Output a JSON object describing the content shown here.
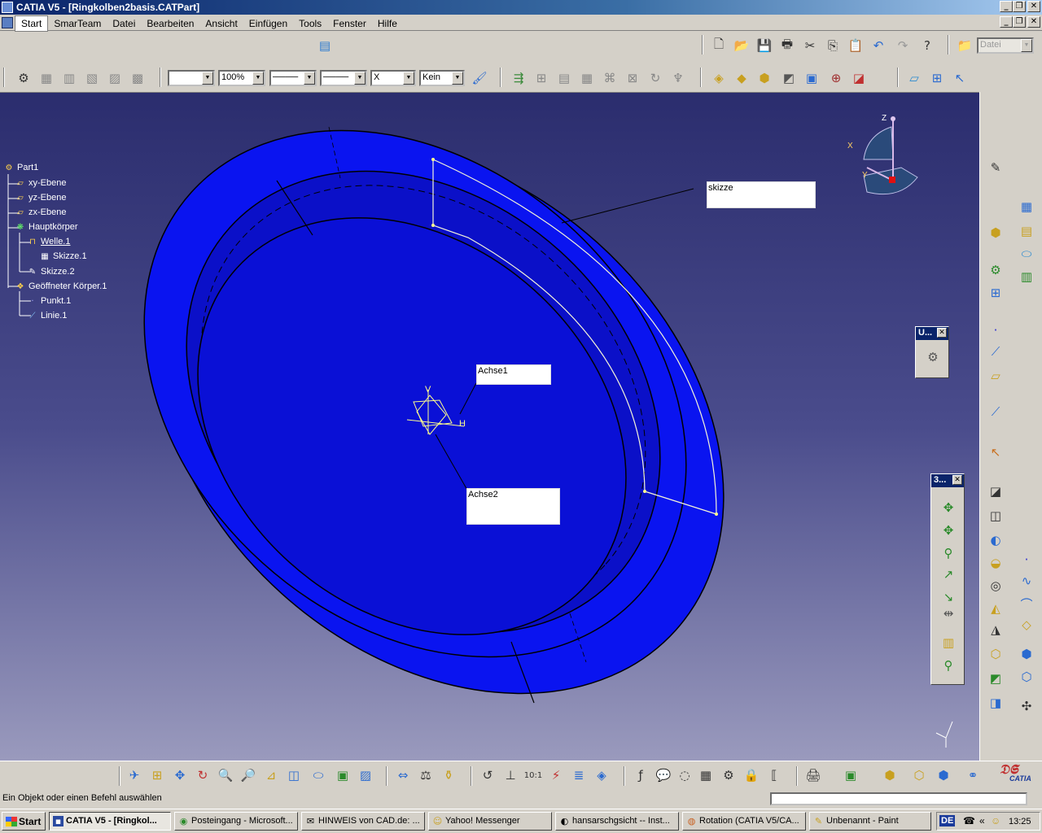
{
  "window": {
    "title": "CATIA V5 - [Ringkolben2basis.CATPart]"
  },
  "menubar": {
    "items": [
      "Start",
      "SmarTeam",
      "Datei",
      "Bearbeiten",
      "Ansicht",
      "Einfügen",
      "Tools",
      "Fenster",
      "Hilfe"
    ]
  },
  "toolbar": {
    "zoom_value": "100%",
    "layer_value": "Kein",
    "datei_value": "Datei",
    "x_value": "X"
  },
  "tree": {
    "root": "Part1",
    "nodes": [
      "xy-Ebene",
      "yz-Ebene",
      "zx-Ebene",
      "Hauptkörper",
      "Welle.1",
      "Skizze.1",
      "Skizze.2",
      "Geöffneter Körper.1",
      "Punkt.1",
      "Linie.1"
    ]
  },
  "annotations": {
    "skizze": "skizze",
    "achse1": "Achse1",
    "achse2": "Achse2"
  },
  "axes": {
    "x": "X",
    "y": "Y",
    "z": "Z",
    "v": "V",
    "h": "H"
  },
  "palettes": {
    "user_title": "U...",
    "three_d_title": "3..."
  },
  "statusbar": {
    "message": "Ein Objekt oder einen Befehl auswählen"
  },
  "taskbar": {
    "start": "Start",
    "tasks": [
      "CATIA V5 - [Ringkol...",
      "Posteingang - Microsoft...",
      "HINWEIS von CAD.de: ...",
      "Yahoo! Messenger",
      "hansarschgsicht -- Inst...",
      "Rotation (CATIA V5/CA...",
      "Unbenannt - Paint"
    ],
    "lang": "DE",
    "time": "13:25"
  },
  "colors": {
    "part_blue": "#0a14f0",
    "part_dark": "#0b0fa8",
    "title_blue": "#0a246a",
    "sketch_yellow": "#ffff8c"
  }
}
